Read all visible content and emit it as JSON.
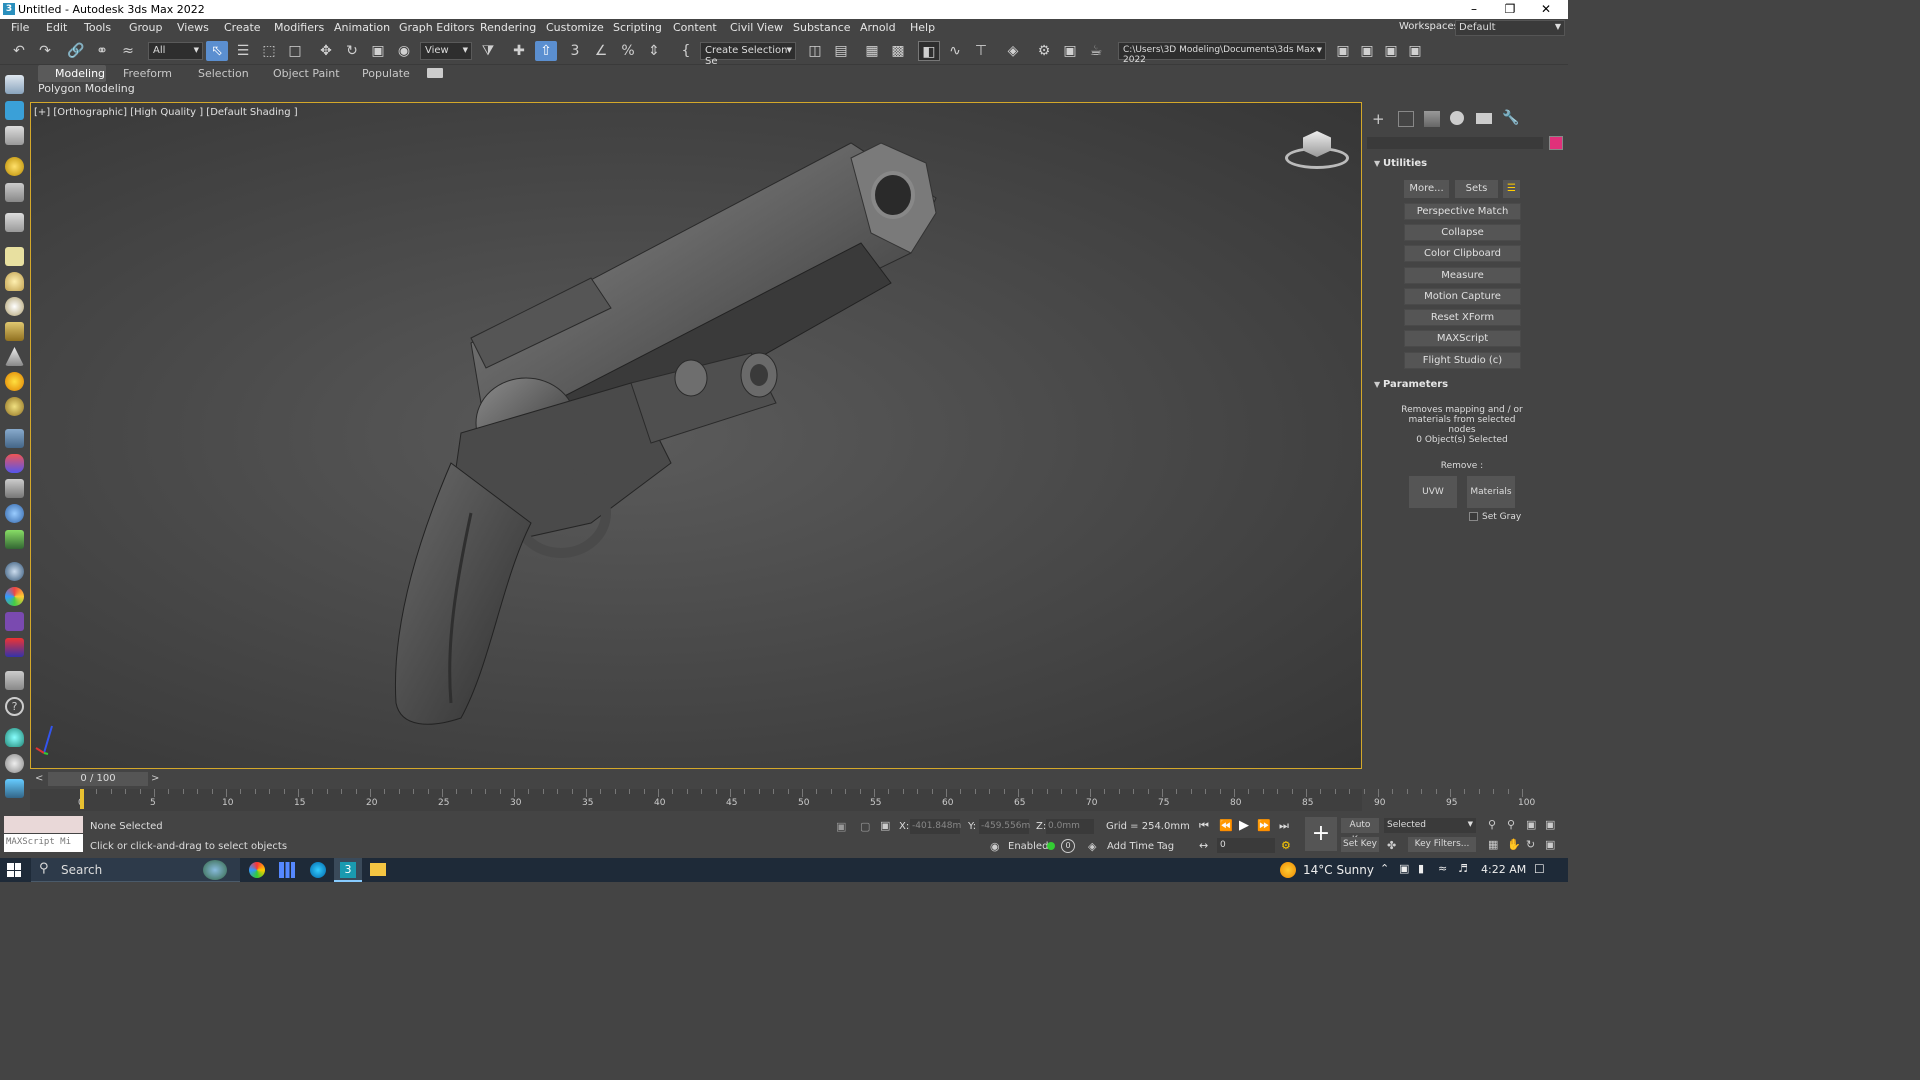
{
  "window": {
    "title": "Untitled - Autodesk 3ds Max 2022",
    "app_badge": "3"
  },
  "menu": [
    "File",
    "Edit",
    "Tools",
    "Group",
    "Views",
    "Create",
    "Modifiers",
    "Animation",
    "Graph Editors",
    "Rendering",
    "Customize",
    "Scripting",
    "Content",
    "Civil View",
    "Substance",
    "Arnold",
    "Help"
  ],
  "workspace": {
    "label": "Workspaces:",
    "value": "Default"
  },
  "toolbar": {
    "filter_value": "All",
    "coord_value": "View",
    "selection_set": "Create Selection Se",
    "project_path": "C:\\Users\\3D Modeling\\Documents\\3ds Max 2022"
  },
  "ribbon": {
    "tabs": [
      "Modeling",
      "Freeform",
      "Selection",
      "Object Paint",
      "Populate"
    ],
    "active": "Modeling",
    "sub_label": "Polygon Modeling"
  },
  "viewport": {
    "label": "[+] [Orthographic] [High Quality ] [Default Shading ]"
  },
  "cmd": {
    "utilities_title": "Utilities",
    "more_btn": "More...",
    "sets_btn": "Sets",
    "buttons": [
      "Perspective Match",
      "Collapse",
      "Color Clipboard",
      "Measure",
      "Motion Capture",
      "Reset XForm",
      "MAXScript",
      "Flight Studio (c)"
    ],
    "params_title": "Parameters",
    "params_desc": "Removes mapping and / or materials from selected nodes",
    "selected_count": "0 Object(s) Selected",
    "remove_label": "Remove :",
    "uvw_btn": "UVW",
    "materials_btn": "Materials",
    "set_gray": "Set Gray",
    "swatch_color": "#e0307a"
  },
  "timeline": {
    "frame_display": "0 / 100",
    "ticks": [
      "0",
      "5",
      "10",
      "15",
      "20",
      "25",
      "30",
      "35",
      "40",
      "45",
      "50",
      "55",
      "60",
      "65",
      "70",
      "75",
      "80",
      "85",
      "90",
      "95",
      "100"
    ],
    "current_frame": 0,
    "total_frames": 100
  },
  "status": {
    "none_selected": "None Selected",
    "hint": "Click or click-and-drag to select objects",
    "maxscript": "MAXScript Mi",
    "x_label": "X:",
    "x_val": "-401.848m",
    "y_label": "Y:",
    "y_val": "-459.556m",
    "z_label": "Z:",
    "z_val": "0.0mm",
    "grid": "Grid = 254.0mm",
    "enabled": "Enabled:",
    "enabled_count": "0",
    "add_time_tag": "Add Time Tag",
    "auto_key": "Auto Key",
    "set_key": "Set Key",
    "selected_dd": "Selected",
    "key_filters": "Key Filters...",
    "frame_spinner": "0"
  },
  "taskbar": {
    "search": "Search",
    "weather": "14°C  Sunny",
    "time": "4:22 AM"
  }
}
